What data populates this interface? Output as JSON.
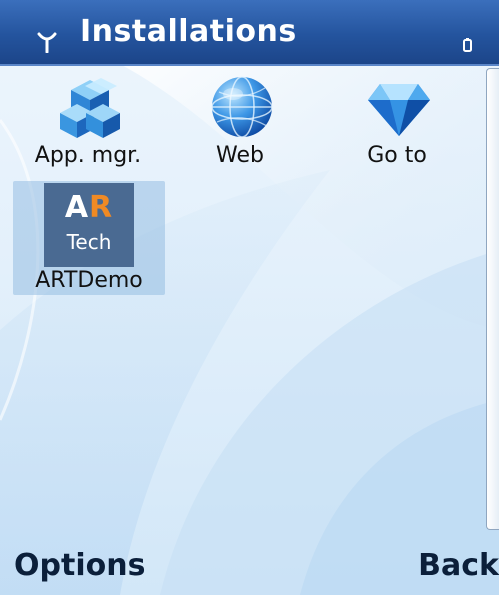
{
  "header": {
    "title": "Installations",
    "signal_icon": "signal-antenna-icon",
    "battery_icon": "battery-icon",
    "bar_color": "#24549e"
  },
  "grid": {
    "items": [
      {
        "label": "App. mgr.",
        "icon": "app-manager-cubes-icon"
      },
      {
        "label": "Web",
        "icon": "globe-icon"
      },
      {
        "label": "Go to",
        "icon": "diamond-icon"
      },
      {
        "label": "ARTDemo",
        "icon": "ar-tech-icon",
        "icon_text_top_a": "A",
        "icon_text_top_r": "R",
        "icon_text_bottom": "Tech",
        "selected": true
      }
    ]
  },
  "softkeys": {
    "left": "Options",
    "right": "Back"
  },
  "colors": {
    "background": "#e3f0fb",
    "selection": "#96bee1",
    "ar_orange": "#f08a24",
    "ar_tile": "#4a6a92"
  }
}
